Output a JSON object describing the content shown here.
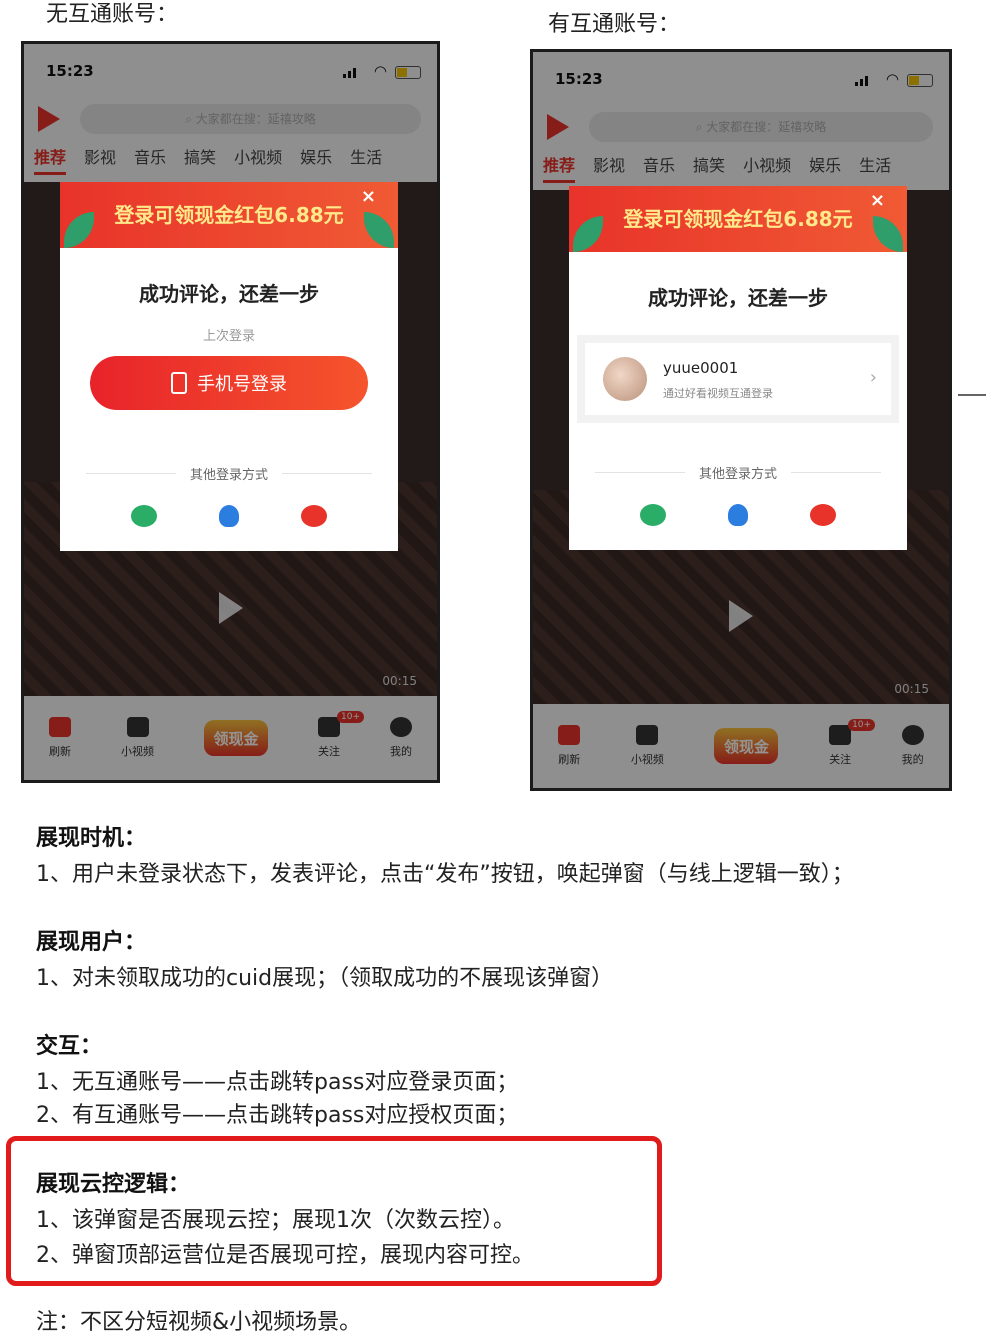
{
  "captions": {
    "left": "无互通账号：",
    "right": "有互通账号："
  },
  "phone": {
    "time": "15:23",
    "search_placeholder": "大家都在搜：延禧攻略",
    "tabs": [
      "推荐",
      "影视",
      "音乐",
      "搞笑",
      "小视频",
      "娱乐",
      "生活"
    ],
    "duration": "00:15",
    "nav": [
      {
        "label": "刷新",
        "icon": "refresh-icon"
      },
      {
        "label": "小视频",
        "icon": "video-camera-icon"
      },
      {
        "label": "领现金",
        "icon": "gold-coin-icon"
      },
      {
        "label": "关注",
        "icon": "follow-icon",
        "badge": "10+"
      },
      {
        "label": "我的",
        "icon": "profile-icon"
      }
    ]
  },
  "modal": {
    "banner": "登录可领现金红包6.88元",
    "close": "×",
    "headline": "成功评论，还差一步",
    "last_login": "上次登录",
    "phone_login": "手机号登录",
    "other_methods": "其他登录方式",
    "account_name": "yuue0001",
    "account_sub": "通过好看视频互通登录",
    "socials": [
      "wechat-icon",
      "qq-icon",
      "weibo-icon"
    ]
  },
  "spec": {
    "timing_title": "展现时机：",
    "timing_1": "1、用户未登录状态下，发表评论，点击“发布”按钮，唤起弹窗（与线上逻辑一致）；",
    "user_title": "展现用户：",
    "user_1": "1、对未领取成功的cuid展现；（领取成功的不展现该弹窗）",
    "interact_title": "交互：",
    "interact_1": "1、无互通账号——点击跳转pass对应登录页面；",
    "interact_2": "2、有互通账号——点击跳转pass对应授权页面；",
    "cloud_title": "展现云控逻辑：",
    "cloud_1": "1、该弹窗是否展现云控；展现1次（次数云控）。",
    "cloud_2": "2、弹窗顶部运营位是否展现可控，展现内容可控。",
    "note": "注：不区分短视频&小视频场景。"
  }
}
